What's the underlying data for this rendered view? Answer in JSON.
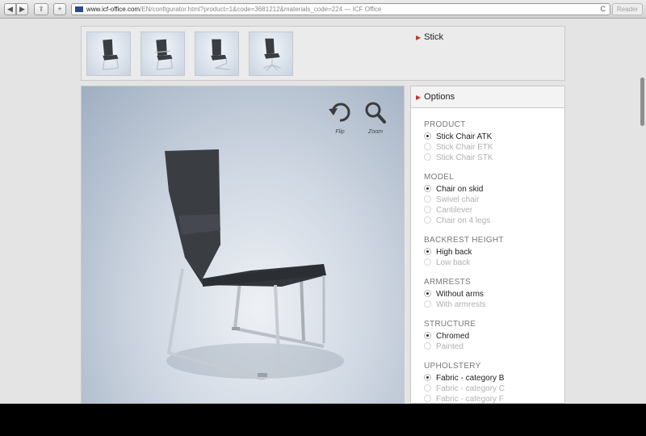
{
  "browser": {
    "back_label": "◀",
    "forward_label": "▶",
    "share_label": "⇪",
    "new_tab_label": "+",
    "url_domain": "www.icf-office.com",
    "url_path": "/EN/configurator.html?product=1&code=3681212&materials_code=224",
    "url_separator": " — ",
    "page_title": "ICF Office",
    "reload_label": "C",
    "reader_label": "Reader"
  },
  "configurator": {
    "product_section_label": "Stick",
    "thumbnails": [
      {
        "name": "thumb-chair-skid"
      },
      {
        "name": "thumb-chair-skid-armrests"
      },
      {
        "name": "thumb-chair-cantilever"
      },
      {
        "name": "thumb-chair-swivel"
      }
    ],
    "tools": [
      {
        "label": "Flip",
        "icon": "flip-icon"
      },
      {
        "label": "Zoom",
        "icon": "zoom-icon"
      }
    ],
    "options_title": "Options",
    "groups": [
      {
        "title": "PRODUCT",
        "options": [
          {
            "label": "Stick Chair ATK",
            "selected": true
          },
          {
            "label": "Stick Chair ETK",
            "selected": false
          },
          {
            "label": "Stick Chair STK",
            "selected": false
          }
        ]
      },
      {
        "title": "MODEL",
        "options": [
          {
            "label": "Chair on skid",
            "selected": true
          },
          {
            "label": "Swivel chair",
            "selected": false
          },
          {
            "label": "Cantilever",
            "selected": false
          },
          {
            "label": "Chair on 4 legs",
            "selected": false
          }
        ]
      },
      {
        "title": "BACKREST HEIGHT",
        "options": [
          {
            "label": "High back",
            "selected": true
          },
          {
            "label": "Low back",
            "selected": false
          }
        ]
      },
      {
        "title": "ARMRESTS",
        "options": [
          {
            "label": "Without arms",
            "selected": true
          },
          {
            "label": "With armrests",
            "selected": false
          }
        ]
      },
      {
        "title": "STRUCTURE",
        "options": [
          {
            "label": "Chromed",
            "selected": true
          },
          {
            "label": "Painted",
            "selected": false
          }
        ]
      },
      {
        "title": "UPHOLSTERY",
        "options": [
          {
            "label": "Fabric - category B",
            "selected": true
          },
          {
            "label": "Fabric - category C",
            "selected": false
          },
          {
            "label": "Fabric - category F",
            "selected": false
          }
        ]
      }
    ]
  },
  "colors": {
    "accent_triangle": "#c0392b",
    "upholstery": "#3a3d42",
    "chrome": "#b9bec6"
  }
}
